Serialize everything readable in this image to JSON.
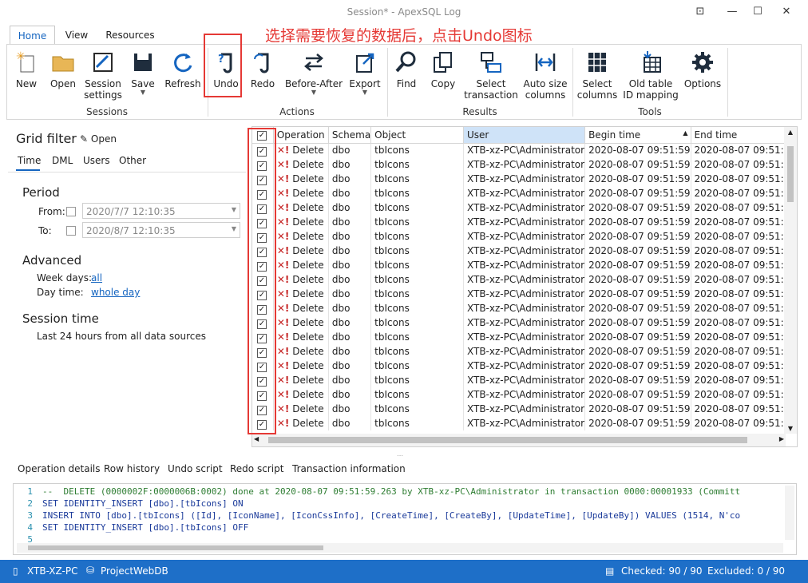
{
  "window": {
    "title": "Session* - ApexSQL Log"
  },
  "tabs": [
    "Home",
    "View",
    "Resources"
  ],
  "ribbon": {
    "sessions": {
      "label": "Sessions",
      "buttons": [
        {
          "label": "New"
        },
        {
          "label": "Open"
        },
        {
          "label": "Session settings",
          "l1": "Session",
          "l2": "settings"
        },
        {
          "label": "Save"
        },
        {
          "label": "Refresh"
        }
      ]
    },
    "actions": {
      "label": "Actions",
      "buttons": [
        {
          "label": "Undo"
        },
        {
          "label": "Redo"
        },
        {
          "label": "Before-After"
        },
        {
          "label": "Export"
        }
      ]
    },
    "results": {
      "label": "Results",
      "buttons": [
        {
          "label": "Find"
        },
        {
          "label": "Copy"
        },
        {
          "l1": "Select",
          "l2": "transaction"
        },
        {
          "l1": "Auto size",
          "l2": "columns"
        }
      ]
    },
    "tools": {
      "label": "Tools",
      "buttons": [
        {
          "l1": "Select",
          "l2": "columns"
        },
        {
          "l1": "Old table",
          "l2": "ID mapping"
        },
        {
          "label": "Options"
        }
      ]
    }
  },
  "annotation": "选择需要恢复的数据后，点击Undo图标",
  "grid_filter": {
    "title": "Grid filter",
    "open": "Open",
    "tabs": [
      "Time",
      "DML",
      "Users",
      "Other"
    ],
    "period": {
      "title": "Period",
      "from_label": "From:",
      "from_value": "2020/7/7 12:10:35",
      "to_label": "To:",
      "to_value": "2020/8/7 12:10:35"
    },
    "advanced": {
      "title": "Advanced",
      "week_label": "Week days:",
      "week_value": "all",
      "day_label": "Day time:",
      "day_value": "whole day"
    },
    "session_time": {
      "title": "Session time",
      "text": "Last 24 hours from all data sources"
    }
  },
  "grid": {
    "columns": [
      "Operation",
      "Schema",
      "Object",
      "User",
      "Begin time",
      "End time"
    ],
    "row": {
      "operation": "Delete",
      "schema": "dbo",
      "object": "tbIcons",
      "user": "XTB-xz-PC\\Administrator",
      "begin": "2020-08-07 09:51:59",
      "end": "2020-08-07 09:51:59"
    },
    "row_count": 20
  },
  "bottom_tabs": [
    "Operation details",
    "Row history",
    "Undo script",
    "Redo script",
    "Transaction information"
  ],
  "script_lines": [
    {
      "n": "1",
      "text": "--  DELETE (0000002F:0000006B:0002) done at 2020-08-07 09:51:59.263 by XTB-xz-PC\\Administrator in transaction 0000:00001933 (Committ"
    },
    {
      "n": "2",
      "text": "SET IDENTITY_INSERT [dbo].[tbIcons] ON"
    },
    {
      "n": "3",
      "text": "INSERT INTO [dbo].[tbIcons] ([Id], [IconName], [IconCssInfo], [CreateTime], [CreateBy], [UpdateTime], [UpdateBy]) VALUES (1514, N'co"
    },
    {
      "n": "4",
      "text": "SET IDENTITY_INSERT [dbo].[tbIcons] OFF"
    },
    {
      "n": "5",
      "text": ""
    }
  ],
  "status": {
    "machine": "XTB-XZ-PC",
    "database": "ProjectWebDB",
    "checked": "Checked: 90 / 90",
    "excluded": "Excluded: 0 / 90"
  }
}
